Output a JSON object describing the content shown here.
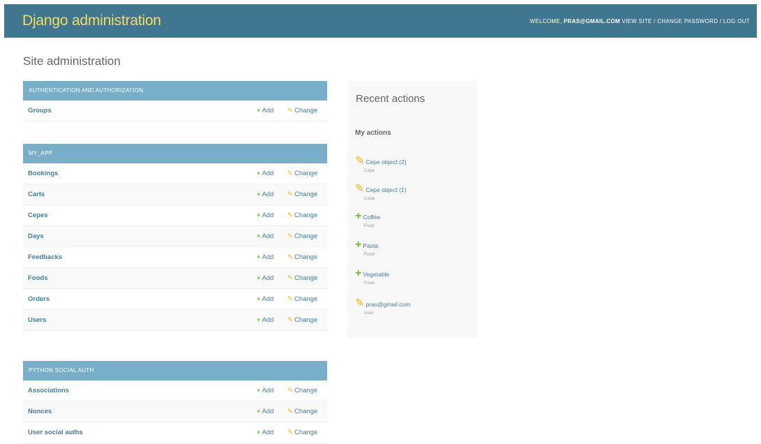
{
  "header": {
    "branding": "Django administration",
    "welcome_prefix": "WELCOME,",
    "username": "PRAS@GMAIL.COM",
    "view_site": "VIEW SITE",
    "change_password": "CHANGE PASSWORD",
    "logout": "LOG OUT"
  },
  "page_title": "Site administration",
  "modules": [
    {
      "caption": "AUTHENTICATION AND AUTHORIZATION",
      "models": [
        {
          "name": "Groups",
          "add": "Add",
          "change": "Change"
        }
      ]
    },
    {
      "caption": "MY_APP",
      "models": [
        {
          "name": "Bookings",
          "add": "Add",
          "change": "Change"
        },
        {
          "name": "Carts",
          "add": "Add",
          "change": "Change"
        },
        {
          "name": "Cepes",
          "add": "Add",
          "change": "Change"
        },
        {
          "name": "Days",
          "add": "Add",
          "change": "Change"
        },
        {
          "name": "Feedbacks",
          "add": "Add",
          "change": "Change"
        },
        {
          "name": "Foods",
          "add": "Add",
          "change": "Change"
        },
        {
          "name": "Orders",
          "add": "Add",
          "change": "Change"
        },
        {
          "name": "Users",
          "add": "Add",
          "change": "Change"
        }
      ]
    },
    {
      "caption": "PYTHON SOCIAL AUTH",
      "models": [
        {
          "name": "Associations",
          "add": "Add",
          "change": "Change"
        },
        {
          "name": "Nonces",
          "add": "Add",
          "change": "Change"
        },
        {
          "name": "User social auths",
          "add": "Add",
          "change": "Change"
        }
      ]
    }
  ],
  "recent": {
    "title": "Recent actions",
    "subtitle": "My actions",
    "items": [
      {
        "icon": "pencil-icon",
        "title": "Cepe object (2)",
        "type": "Cepe"
      },
      {
        "icon": "pencil-icon",
        "title": "Cepe object (1)",
        "type": "Cepe"
      },
      {
        "icon": "plus-icon",
        "title": "Coffee",
        "type": "Food"
      },
      {
        "icon": "plus-icon",
        "title": "Pasta",
        "type": "Food"
      },
      {
        "icon": "plus-icon",
        "title": "Vegetable",
        "type": "Food"
      },
      {
        "icon": "pencil-icon",
        "title": "pras@gmail.com",
        "type": "User"
      }
    ]
  },
  "colors": {
    "header_bg": "#417690",
    "branding": "#f5dd5d",
    "module_caption_bg": "#79aec8",
    "link": "#447e9b",
    "add_icon": "#70bf2b",
    "change_icon": "#efb80b"
  }
}
